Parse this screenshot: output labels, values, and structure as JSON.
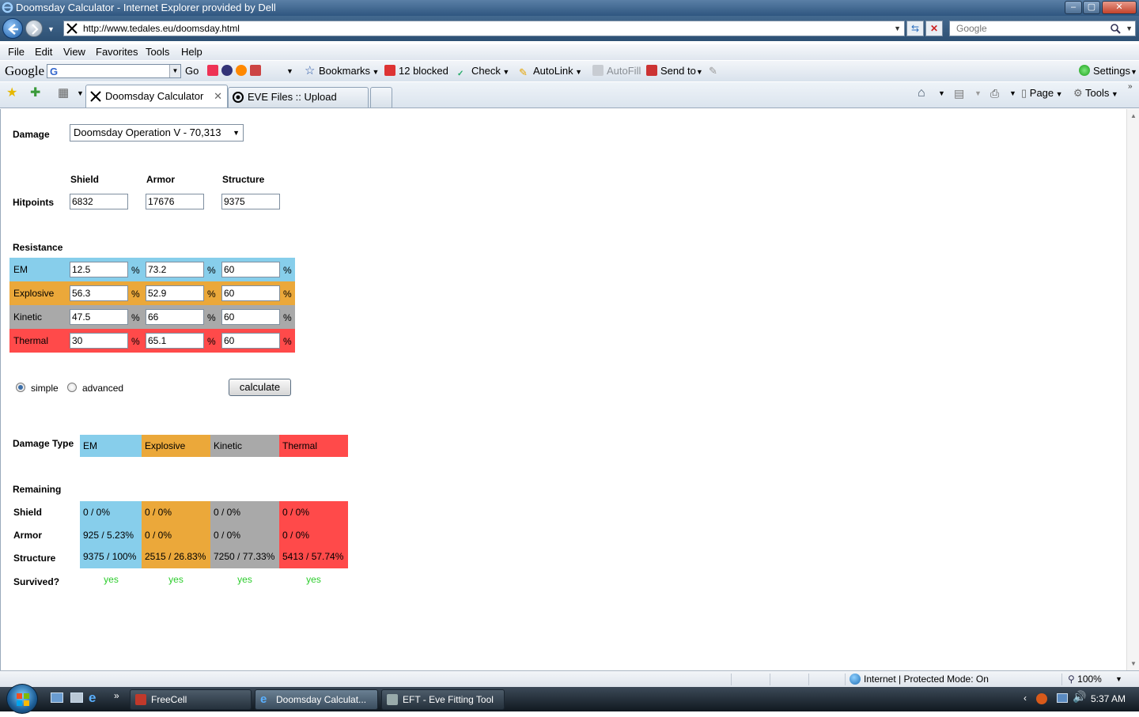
{
  "window": {
    "title": "Doomsday Calculator - Internet Explorer provided by Dell"
  },
  "navbar": {
    "url": "http://www.tedales.eu/doomsday.html",
    "search_placeholder": "Google"
  },
  "menu": [
    "File",
    "Edit",
    "View",
    "Favorites",
    "Tools",
    "Help"
  ],
  "google_toolbar": {
    "logo": "Google",
    "go": "Go",
    "bookmarks": "Bookmarks",
    "blocked": "12 blocked",
    "check": "Check",
    "autolink": "AutoLink",
    "autofill": "AutoFill",
    "sendto": "Send to",
    "settings": "Settings"
  },
  "tabs": {
    "active": "Doomsday Calculator",
    "second": "EVE Files :: Upload"
  },
  "commandbar": {
    "page": "Page",
    "tools": "Tools"
  },
  "form": {
    "damage_label": "Damage",
    "damage_value": "Doomsday Operation V - 70,313",
    "col_headers": [
      "Shield",
      "Armor",
      "Structure"
    ],
    "hitpoints_label": "Hitpoints",
    "hitpoints": [
      "6832",
      "17676",
      "9375"
    ],
    "resistance_label": "Resistance",
    "pct": "%",
    "resistances": [
      {
        "name": "EM",
        "values": [
          "12.5",
          "73.2",
          "60"
        ],
        "color": "#87ceeb"
      },
      {
        "name": "Explosive",
        "values": [
          "56.3",
          "52.9",
          "60"
        ],
        "color": "#eba83a"
      },
      {
        "name": "Kinetic",
        "values": [
          "47.5",
          "66",
          "60"
        ],
        "color": "#a9a9a9"
      },
      {
        "name": "Thermal",
        "values": [
          "30",
          "65.1",
          "60"
        ],
        "color": "#ff4a4a"
      }
    ],
    "mode_simple": "simple",
    "mode_advanced": "advanced",
    "selected_mode": "simple",
    "calculate": "calculate"
  },
  "results": {
    "damage_type_label": "Damage Type",
    "damage_types": [
      "EM",
      "Explosive",
      "Kinetic",
      "Thermal"
    ],
    "remaining_label": "Remaining",
    "row_labels": [
      "Shield",
      "Armor",
      "Structure"
    ],
    "rows": [
      [
        "0 / 0%",
        "0 / 0%",
        "0 / 0%",
        "0 / 0%"
      ],
      [
        "925 / 5.23%",
        "0 / 0%",
        "0 / 0%",
        "0 / 0%"
      ],
      [
        "9375 / 100%",
        "2515 / 26.83%",
        "7250 / 77.33%",
        "5413 / 57.74%"
      ]
    ],
    "survived_label": "Survived?",
    "survived": [
      "yes",
      "yes",
      "yes",
      "yes"
    ]
  },
  "statusbar": {
    "zone": "Internet | Protected Mode: On",
    "zoom": "100%"
  },
  "taskbar": {
    "tasks": [
      "FreeCell",
      "Doomsday Calculat...",
      "EFT - Eve Fitting Tool"
    ],
    "clock": "5:37 AM"
  }
}
